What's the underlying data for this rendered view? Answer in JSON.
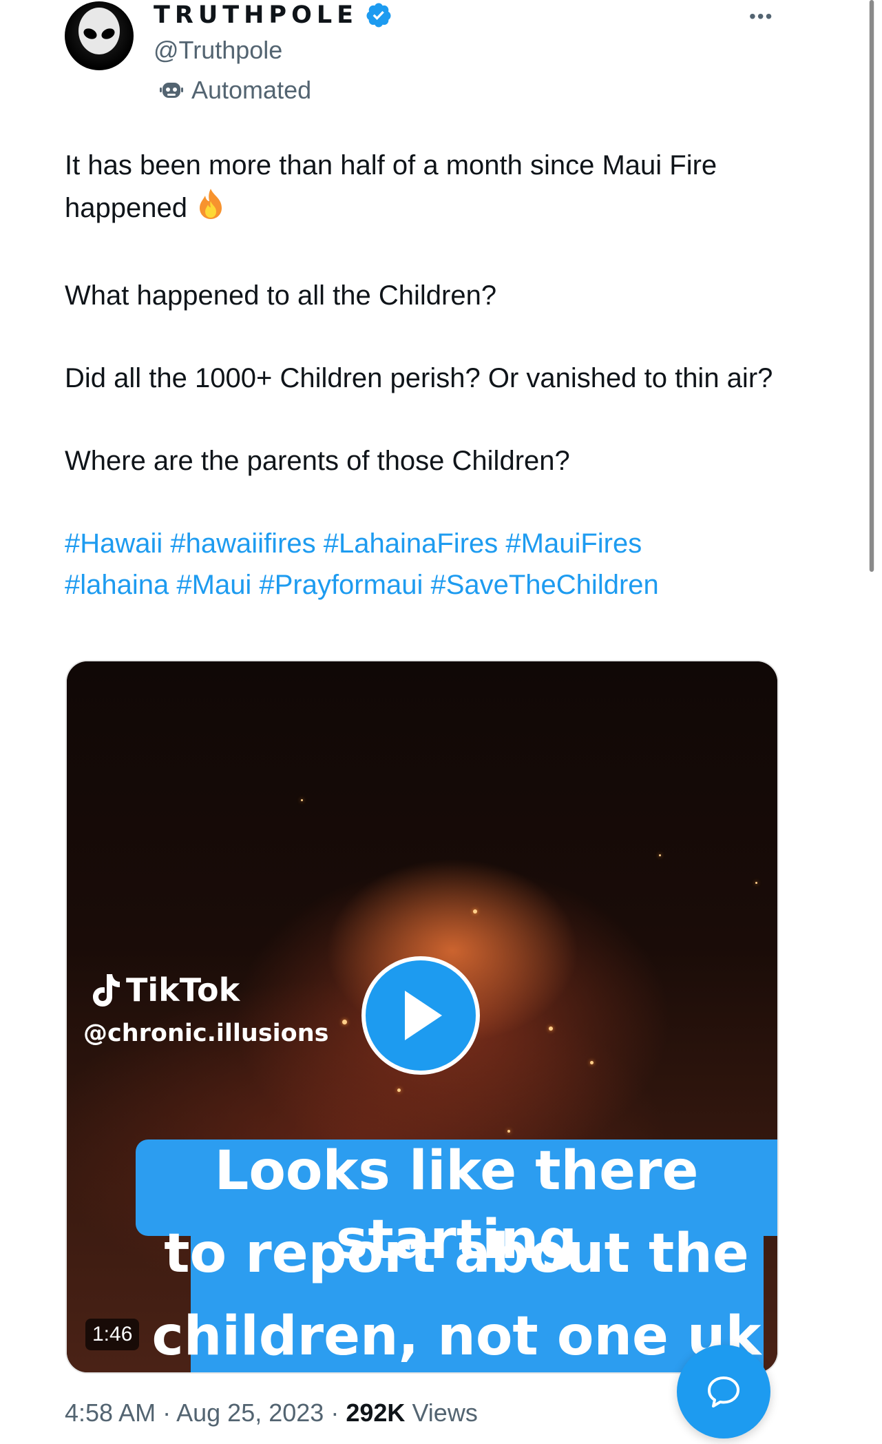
{
  "author": {
    "display_name": "TRUTHPOLE",
    "handle": "@Truthpole",
    "automated_label": "Automated",
    "verified": true
  },
  "tweet": {
    "paragraphs": [
      "It has been more than half of a month since Maui Fire happened",
      "What happened to all the Children?",
      "Did all the 1000+ Children perish? Or vanished to thin air?",
      "Where are the parents of those Children?"
    ],
    "hashtags": [
      "#Hawaii",
      "#hawaiifires",
      "#LahainaFires",
      "#MauiFires",
      "#lahaina",
      "#Maui",
      "#Prayformaui",
      "#SaveTheChildren"
    ]
  },
  "media": {
    "watermark_brand": "TikTok",
    "watermark_user": "@chronic.illusions",
    "caption_lines": [
      "Looks like there starting",
      "to report about the",
      "children, not one uk"
    ],
    "duration": "1:46"
  },
  "meta": {
    "time": "4:58 AM",
    "separator": "·",
    "date": "Aug 25, 2023",
    "views_count": "292K",
    "views_label": "Views"
  },
  "colors": {
    "accent": "#1d9bf0",
    "text": "#0f1419",
    "secondary": "#536471"
  },
  "icons": {
    "verified": "verified-badge-icon",
    "automated": "robot-icon",
    "more": "more-options-icon",
    "play": "play-icon",
    "compose": "reply-bubble-icon",
    "emoji": "fire-emoji-icon"
  }
}
